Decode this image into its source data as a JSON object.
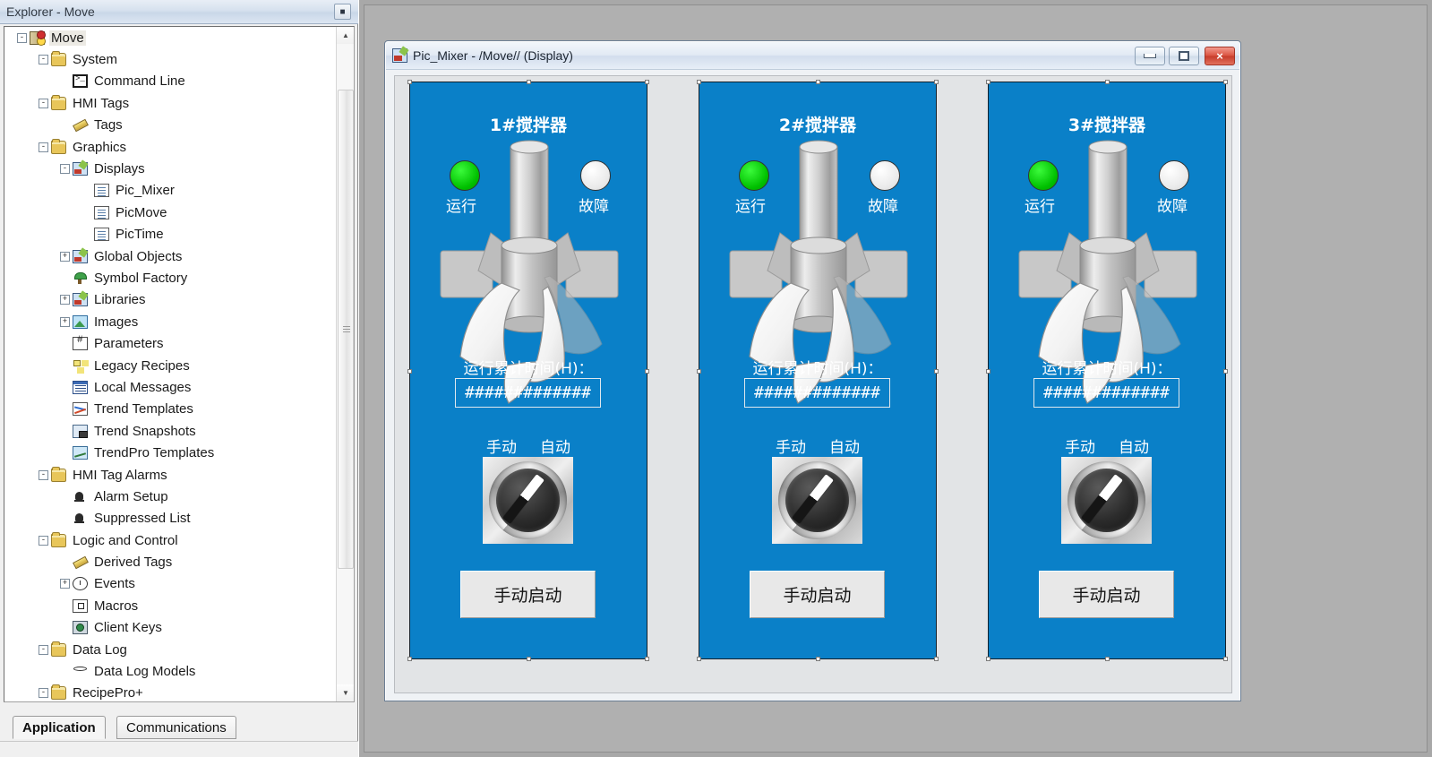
{
  "explorer": {
    "title": "Explorer - Move",
    "close_icon": "close-icon",
    "tabs": [
      {
        "label": "Application",
        "active": true
      },
      {
        "label": "Communications",
        "active": false
      }
    ],
    "tree": [
      {
        "label": "Move",
        "depth": 0,
        "expander": "-",
        "icon": "ic-project",
        "selected": true
      },
      {
        "label": "System",
        "depth": 1,
        "expander": "-",
        "icon": "ic-folder",
        "selected": false
      },
      {
        "label": "Command Line",
        "depth": 2,
        "expander": "none",
        "icon": "ic-cmd",
        "selected": false
      },
      {
        "label": "HMI Tags",
        "depth": 1,
        "expander": "-",
        "icon": "ic-folder",
        "selected": false
      },
      {
        "label": "Tags",
        "depth": 2,
        "expander": "none",
        "icon": "ic-pencil",
        "selected": false
      },
      {
        "label": "Graphics",
        "depth": 1,
        "expander": "-",
        "icon": "ic-folder",
        "selected": false
      },
      {
        "label": "Displays",
        "depth": 2,
        "expander": "-",
        "icon": "ic-graphic",
        "selected": false
      },
      {
        "label": "Pic_Mixer",
        "depth": 3,
        "expander": "none",
        "icon": "ic-doc",
        "selected": false
      },
      {
        "label": "PicMove",
        "depth": 3,
        "expander": "none",
        "icon": "ic-doc",
        "selected": false
      },
      {
        "label": "PicTime",
        "depth": 3,
        "expander": "none",
        "icon": "ic-doc",
        "selected": false
      },
      {
        "label": "Global Objects",
        "depth": 2,
        "expander": "+",
        "icon": "ic-graphic",
        "selected": false
      },
      {
        "label": "Symbol Factory",
        "depth": 2,
        "expander": "none",
        "icon": "ic-symbol",
        "selected": false
      },
      {
        "label": "Libraries",
        "depth": 2,
        "expander": "+",
        "icon": "ic-graphic",
        "selected": false
      },
      {
        "label": "Images",
        "depth": 2,
        "expander": "+",
        "icon": "ic-image",
        "selected": false
      },
      {
        "label": "Parameters",
        "depth": 2,
        "expander": "none",
        "icon": "ic-param",
        "selected": false
      },
      {
        "label": "Legacy Recipes",
        "depth": 2,
        "expander": "none",
        "icon": "ic-recipe",
        "selected": false
      },
      {
        "label": "Local Messages",
        "depth": 2,
        "expander": "none",
        "icon": "ic-msg",
        "selected": false
      },
      {
        "label": "Trend Templates",
        "depth": 2,
        "expander": "none",
        "icon": "ic-trend",
        "selected": false
      },
      {
        "label": "Trend Snapshots",
        "depth": 2,
        "expander": "none",
        "icon": "ic-snap",
        "selected": false
      },
      {
        "label": "TrendPro Templates",
        "depth": 2,
        "expander": "none",
        "icon": "ic-trendpro",
        "selected": false
      },
      {
        "label": "HMI Tag Alarms",
        "depth": 1,
        "expander": "-",
        "icon": "ic-folder",
        "selected": false
      },
      {
        "label": "Alarm Setup",
        "depth": 2,
        "expander": "none",
        "icon": "ic-bell",
        "selected": false
      },
      {
        "label": "Suppressed List",
        "depth": 2,
        "expander": "none",
        "icon": "ic-bell",
        "selected": false
      },
      {
        "label": "Logic and Control",
        "depth": 1,
        "expander": "-",
        "icon": "ic-folder",
        "selected": false
      },
      {
        "label": "Derived Tags",
        "depth": 2,
        "expander": "none",
        "icon": "ic-pencil",
        "selected": false
      },
      {
        "label": "Events",
        "depth": 2,
        "expander": "+",
        "icon": "ic-clock",
        "selected": false
      },
      {
        "label": "Macros",
        "depth": 2,
        "expander": "none",
        "icon": "ic-macro",
        "selected": false
      },
      {
        "label": "Client Keys",
        "depth": 2,
        "expander": "none",
        "icon": "ic-keys",
        "selected": false
      },
      {
        "label": "Data Log",
        "depth": 1,
        "expander": "-",
        "icon": "ic-folder",
        "selected": false
      },
      {
        "label": "Data Log Models",
        "depth": 2,
        "expander": "none",
        "icon": "ic-datalog",
        "selected": false
      },
      {
        "label": "RecipePro+",
        "depth": 1,
        "expander": "-",
        "icon": "ic-folder",
        "selected": false
      }
    ],
    "scrollbar": {
      "up_icon": "scroll-up-arrow",
      "down_icon": "scroll-down-arrow"
    }
  },
  "display_window": {
    "title": "Pic_Mixer - /Move// (Display)",
    "icon": "display-document-icon",
    "buttons": {
      "minimize": "minimize-icon",
      "maximize": "maximize-icon",
      "close": "×"
    }
  },
  "colors": {
    "panel_blue": "#0a80c8",
    "lamp_run_on": "#00c000",
    "lamp_fault_off": "#eaeaea",
    "button_face": "#e8e8e8",
    "title_text": "#ffffff"
  },
  "mixers": [
    {
      "title": "1#搅拌器",
      "run_label": "运行",
      "fault_label": "故障",
      "run_state": "on",
      "fault_state": "off",
      "hours_label": "运行累计时间(H)：",
      "hours_value": "#############",
      "switch_manual": "手动",
      "switch_auto": "自动",
      "start_button": "手动启动"
    },
    {
      "title": "2#搅拌器",
      "run_label": "运行",
      "fault_label": "故障",
      "run_state": "on",
      "fault_state": "off",
      "hours_label": "运行累计时间(H)：",
      "hours_value": "#############",
      "switch_manual": "手动",
      "switch_auto": "自动",
      "start_button": "手动启动"
    },
    {
      "title": "3#搅拌器",
      "run_label": "运行",
      "fault_label": "故障",
      "run_state": "on",
      "fault_state": "off",
      "hours_label": "运行累计时间(H)：",
      "hours_value": "#############",
      "switch_manual": "手动",
      "switch_auto": "自动",
      "start_button": "手动启动"
    }
  ]
}
